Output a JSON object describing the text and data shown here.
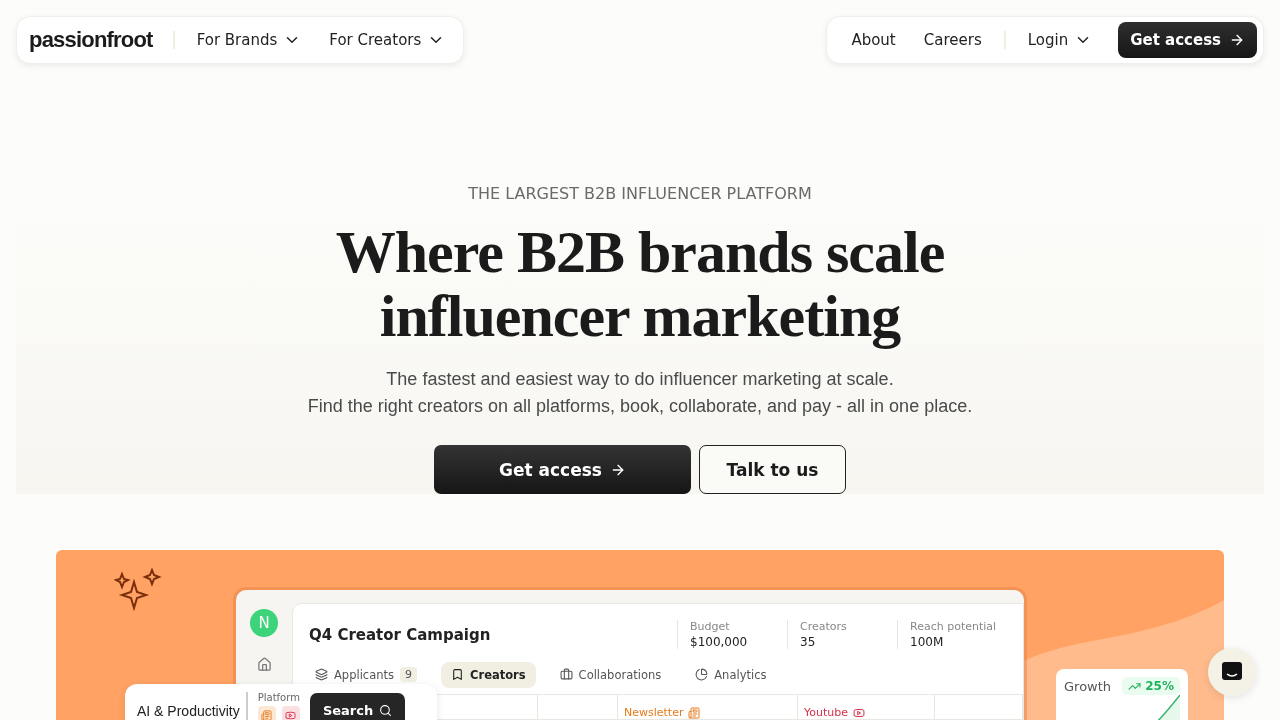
{
  "nav": {
    "logo": "passionfroot",
    "left_menu": [
      {
        "label": "For Brands",
        "dropdown": true
      },
      {
        "label": "For Creators",
        "dropdown": true
      }
    ],
    "right_links": [
      {
        "label": "About"
      },
      {
        "label": "Careers"
      }
    ],
    "login": {
      "label": "Login",
      "dropdown": true
    },
    "cta": "Get access"
  },
  "hero": {
    "kicker": "THE LARGEST B2B INFLUENCER PLATFORM",
    "title": "Where B2B brands scale influencer marketing",
    "subtitle": [
      "The fastest and easiest way to do influencer marketing at scale.",
      "Find the right creators on all platforms, book, collaborate, and pay - all in one place."
    ],
    "buttons": [
      {
        "label": "Get access",
        "kind": "primary"
      },
      {
        "label": "Talk to us",
        "kind": "secondary"
      }
    ]
  },
  "mockup": {
    "avatar": "N",
    "campaign_title": "Q4 Creator Campaign",
    "stats": [
      {
        "label": "Budget",
        "value": "$100,000"
      },
      {
        "label": "Creators",
        "value": "35"
      },
      {
        "label": "Reach potential",
        "value": "100M"
      }
    ],
    "tabs": [
      {
        "label": "Applicants",
        "badge": "9",
        "kind": "stack",
        "selected": false
      },
      {
        "label": "Creators",
        "kind": "bookmark",
        "selected": true
      },
      {
        "label": "Collaborations",
        "kind": "briefcase",
        "selected": false
      },
      {
        "label": "Analytics",
        "kind": "pie",
        "selected": false
      }
    ],
    "columns": [
      {
        "label": "Newsletter",
        "kind": "newsletter"
      },
      {
        "label": "Youtube",
        "kind": "youtube"
      }
    ],
    "search_card": {
      "category": "AI & Productivity",
      "platform_label": "Platform",
      "button": "Search"
    },
    "growth": {
      "label": "Growth",
      "change": "25%"
    }
  }
}
